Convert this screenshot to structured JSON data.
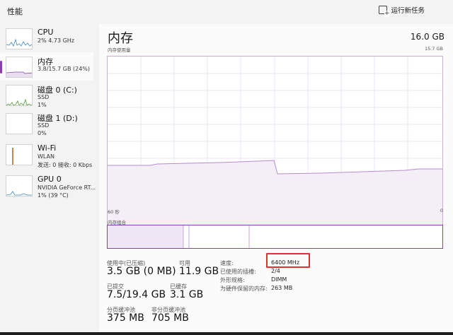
{
  "window": {
    "title": "性能",
    "run_task": "运行新任务"
  },
  "sidebar": {
    "items": [
      {
        "name": "CPU",
        "line1": "2% 4.73 GHz",
        "line2": ""
      },
      {
        "name": "内存",
        "line1": "3.8/15.7 GB (24%)",
        "line2": ""
      },
      {
        "name": "磁盘 0 (C:)",
        "line1": "SSD",
        "line2": "1%"
      },
      {
        "name": "磁盘 1 (D:)",
        "line1": "SSD",
        "line2": "0%"
      },
      {
        "name": "Wi-Fi",
        "line1": "WLAN",
        "line2": "发送: 0 接收: 0 Kbps"
      },
      {
        "name": "GPU 0",
        "line1": "NVIDIA GeForce RT...",
        "line2": "1% (39 °C)"
      }
    ]
  },
  "main": {
    "title": "内存",
    "total": "16.0 GB",
    "usage_label": "内存使用量",
    "usage_max": "15.7 GB",
    "axis_left": "60 秒",
    "axis_right": "0",
    "composition_label": "内存组合",
    "stats": {
      "in_use_label": "使用中(已压缩)",
      "in_use_value": "3.5 GB (0 MB)",
      "available_label": "可用",
      "available_value": "11.9 GB",
      "committed_label": "已提交",
      "committed_value": "7.5/19.4 GB",
      "cached_label": "已缓存",
      "cached_value": "3.1 GB",
      "paged_label": "分页缓冲池",
      "paged_value": "375 MB",
      "nonpaged_label": "非分页缓冲池",
      "nonpaged_value": "705 MB"
    },
    "details": [
      {
        "label": "速度:",
        "value": "6400 MHz"
      },
      {
        "label": "已使用的插槽:",
        "value": "2/4"
      },
      {
        "label": "外形规格:",
        "value": "DIMM"
      },
      {
        "label": "为硬件保留的内存:",
        "value": "263 MB"
      }
    ]
  },
  "colors": {
    "accent": "#8a3eb3",
    "highlight": "#e03030"
  }
}
